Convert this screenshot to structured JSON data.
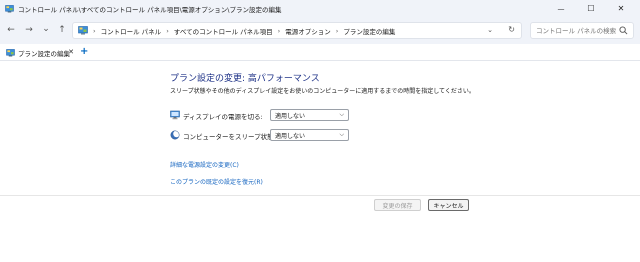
{
  "window": {
    "title": "コントロール パネル\\すべてのコントロール パネル項目\\電源オプション\\プラン設定の編集",
    "minimize_glyph": "—",
    "maximize_glyph": "☐",
    "close_glyph": "✕"
  },
  "nav": {
    "back_glyph": "←",
    "forward_glyph": "→",
    "recent_glyph": "⌄",
    "up_glyph": "↑",
    "breadcrumbs": [
      "コントロール パネル",
      "すべてのコントロール パネル項目",
      "電源オプション",
      "プラン設定の編集"
    ],
    "separator": "›",
    "lead_separator": "›",
    "dropdown_glyph": "⌄",
    "refresh_glyph": "↻",
    "search_placeholder": "コントロール パネルの検索"
  },
  "tabs": [
    {
      "label": "プラン設定の編集",
      "close_glyph": "✕"
    }
  ],
  "new_tab_glyph": "+",
  "main": {
    "heading": "プラン設定の変更: 高パフォーマンス",
    "subtext": "スリープ状態やその他のディスプレイ設定をお使いのコンピューターに適用するまでの時間を指定してください。",
    "settings": [
      {
        "label": "ディスプレイの電源を切る:",
        "value": "適用しない"
      },
      {
        "label": "コンピューターをスリープ状態にする:",
        "value": "適用しない"
      }
    ],
    "caret_glyph": "⌵",
    "links": [
      "詳細な電源設定の変更(C)",
      "このプランの既定の設定を復元(R)"
    ],
    "save_label": "変更の保存",
    "cancel_label": "キャンセル"
  },
  "colors": {
    "heading": "#1e3287",
    "link": "#1565c0",
    "chrome_bg": "#f0f3f9",
    "accent": "#0067c0"
  }
}
